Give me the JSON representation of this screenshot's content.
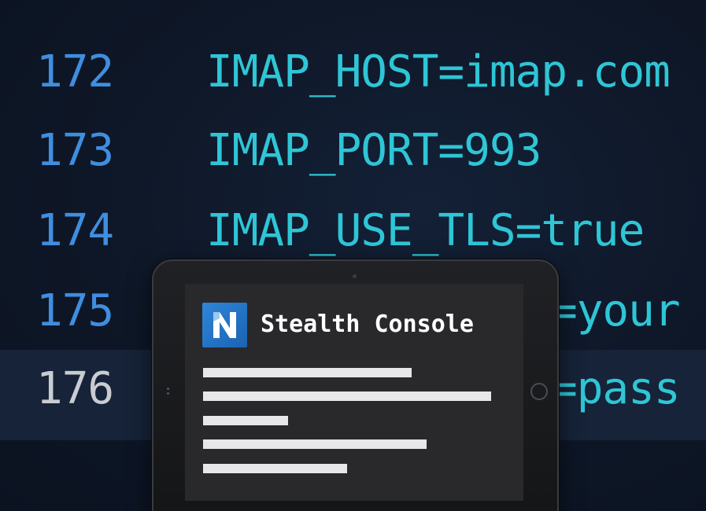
{
  "editor": {
    "lines": [
      {
        "number": "172",
        "code": "IMAP_HOST=imap.com"
      },
      {
        "number": "173",
        "code": "IMAP_PORT=993"
      },
      {
        "number": "174",
        "code": "IMAP_USE_TLS=true"
      },
      {
        "number": "175",
        "code": "=your"
      },
      {
        "number": "176",
        "code": "=pass"
      }
    ],
    "current_line": "176"
  },
  "tablet": {
    "app_title": "Stealth Console",
    "logo_letter": "N",
    "placeholder_line_count": 5
  },
  "colors": {
    "background": "#0e1626",
    "line_number": "#3f8ee0",
    "current_line_number": "#c9ccd2",
    "code_text": "#2ec6d6",
    "logo_blue": "#2f86d8",
    "screen": "#29292c",
    "placeholder_bar": "#e7e7ea"
  }
}
